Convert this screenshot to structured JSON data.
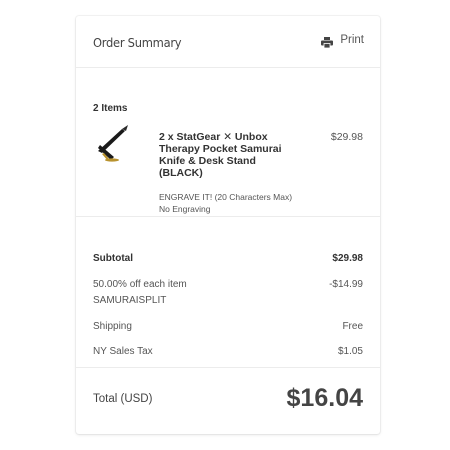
{
  "header": {
    "title": "Order Summary",
    "print_label": "Print",
    "print_icon": "printer-icon"
  },
  "items": {
    "count_label": "2 Items",
    "list": [
      {
        "thumbnail": "knife-stand-image",
        "name": "2 x StatGear ✕ Unbox Therapy Pocket Samurai Knife & Desk Stand (BLACK)",
        "price": "$29.98",
        "option": "ENGRAVE IT! (20 Characters Max) No Engraving"
      }
    ]
  },
  "totals": {
    "subtotal_label": "Subtotal",
    "subtotal_value": "$29.98",
    "discount_label": "50.00% off each item",
    "discount_value": "-$14.99",
    "discount_code": "SAMURAISPLIT",
    "shipping_label": "Shipping",
    "shipping_value": "Free",
    "tax_label": "NY Sales Tax",
    "tax_value": "$1.05"
  },
  "grand_total": {
    "label": "Total (USD)",
    "value": "$16.04"
  },
  "colors": {
    "text_primary": "#333333",
    "text_secondary": "#555555",
    "divider": "#ececec",
    "knife_gold": "#b8922e"
  }
}
